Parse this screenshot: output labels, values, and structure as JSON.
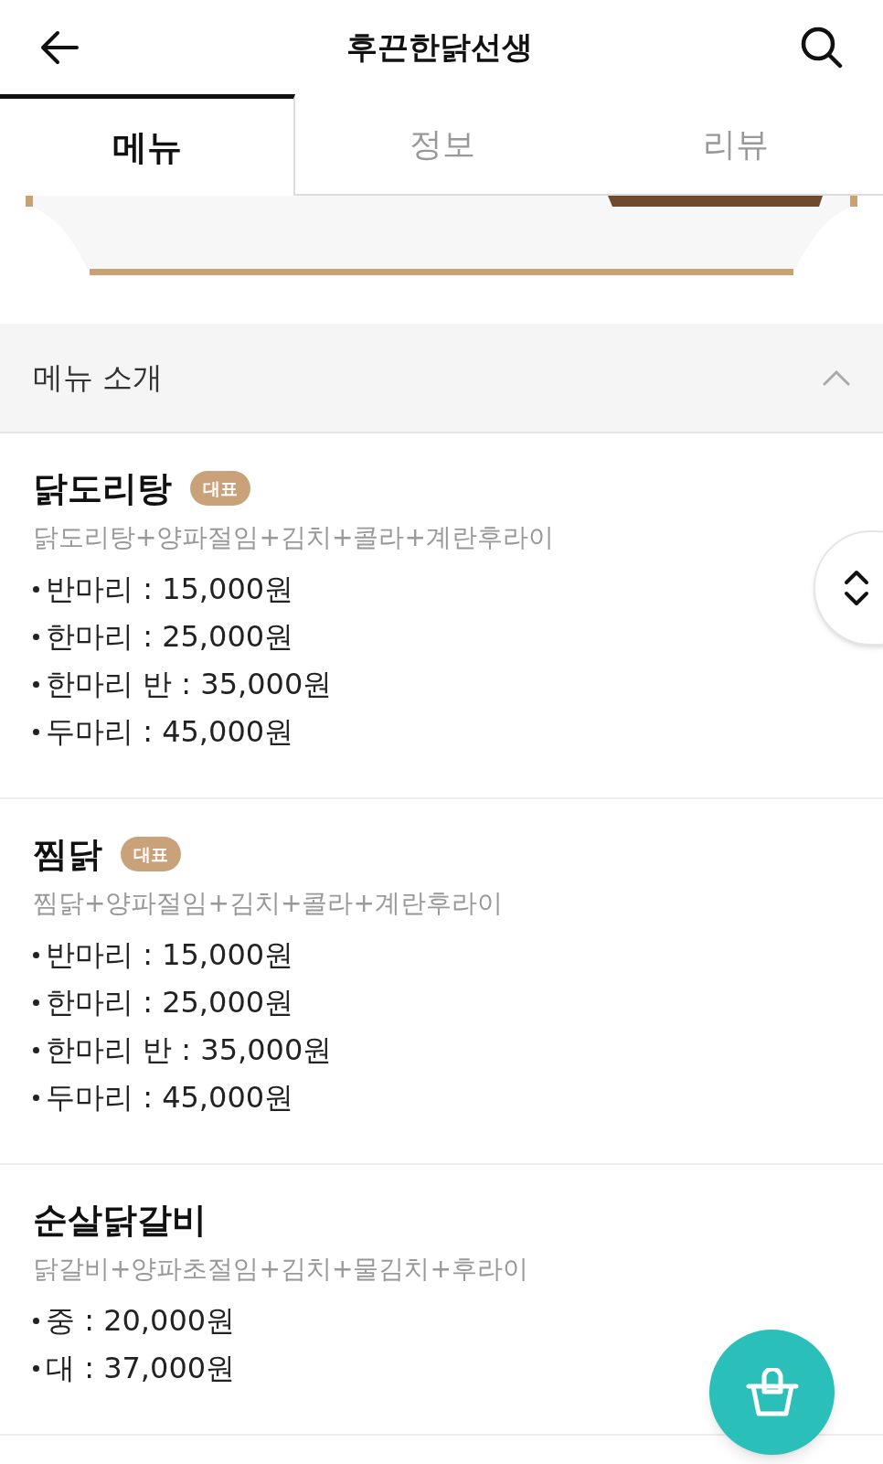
{
  "header": {
    "title": "후끈한닭선생"
  },
  "tabs": [
    {
      "label": "메뉴",
      "selected": true
    },
    {
      "label": "정보",
      "selected": false
    },
    {
      "label": "리뷰",
      "selected": false
    }
  ],
  "section": {
    "title": "메뉴 소개",
    "expanded": true
  },
  "menu_items": [
    {
      "name": "닭도리탕",
      "badge": "대표",
      "description": "닭도리탕+양파절임+김치+콜라+계란후라이",
      "prices": [
        "반마리 : 15,000원",
        "한마리 : 25,000원",
        "한마리 반 : 35,000원",
        "두마리 : 45,000원"
      ]
    },
    {
      "name": "찜닭",
      "badge": "대표",
      "description": "찜닭+양파절임+김치+콜라+계란후라이",
      "prices": [
        "반마리 : 15,000원",
        "한마리 : 25,000원",
        "한마리 반 : 35,000원",
        "두마리 : 45,000원"
      ]
    },
    {
      "name": "순살닭갈비",
      "description": "닭갈비+양파초절임+김치+물김치+후라이",
      "prices": [
        "중 : 20,000원",
        "대 : 37,000원"
      ]
    }
  ]
}
